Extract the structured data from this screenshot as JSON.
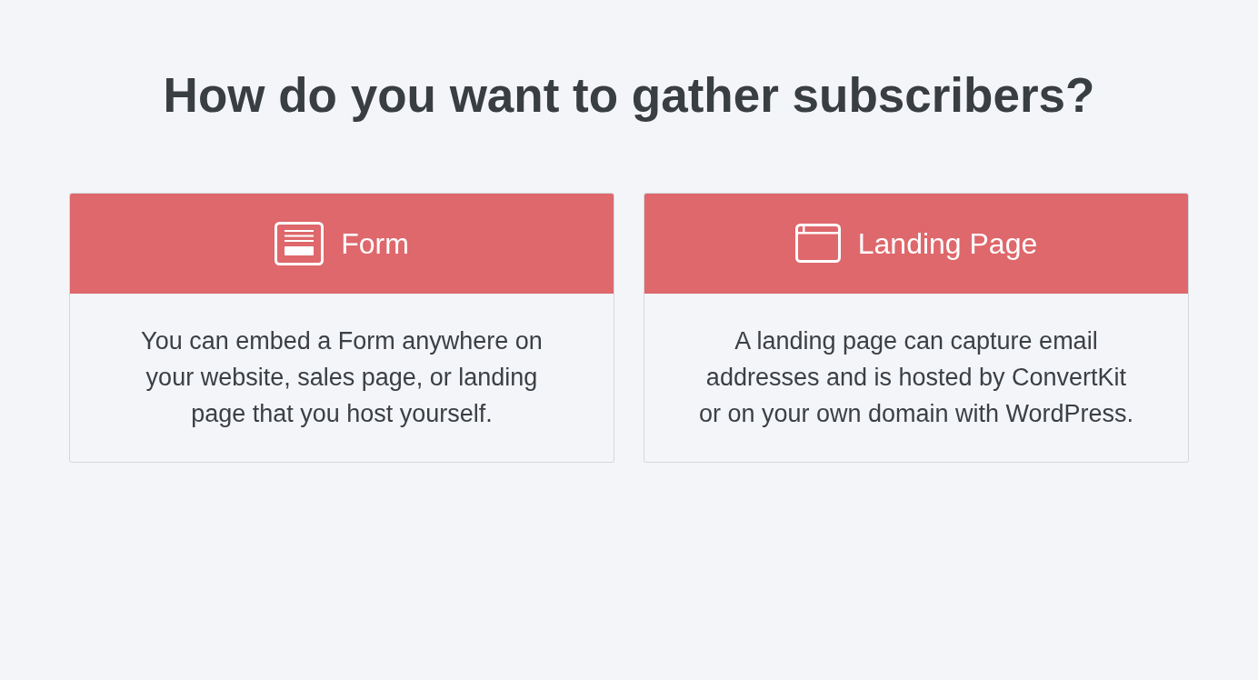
{
  "heading": "How do you want to gather subscribers?",
  "options": [
    {
      "kind": "form",
      "title": "Form",
      "description": "You can embed a Form anywhere on your website, sales page, or landing page that you host yourself."
    },
    {
      "kind": "landing_page",
      "title": "Landing Page",
      "description": "A landing page can capture email addresses and is hosted by ConvertKit or on your own domain with WordPress."
    }
  ]
}
